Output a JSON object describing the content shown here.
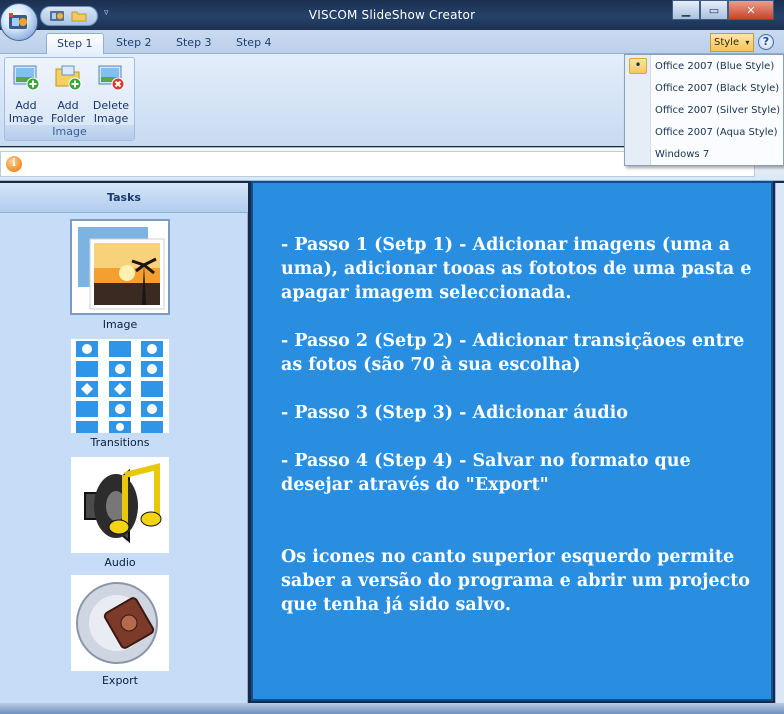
{
  "window": {
    "title": "VISCOM SlideShow Creator",
    "controls": {
      "minimize": "▁",
      "maximize": "▭",
      "close": "✕"
    }
  },
  "tabs": [
    "Step 1",
    "Step 2",
    "Step 3",
    "Step 4"
  ],
  "active_tab": "Step 1",
  "style_button": "Style",
  "help_button": "?",
  "ribbon": {
    "group_label": "Image",
    "buttons": [
      {
        "line1": "Add",
        "line2": "Image",
        "icon": "add-image-icon"
      },
      {
        "line1": "Add",
        "line2": "Folder",
        "icon": "add-folder-icon"
      },
      {
        "line1": "Delete",
        "line2": "Image",
        "icon": "delete-image-icon"
      }
    ]
  },
  "info_icon": "i",
  "tasks": {
    "header": "Tasks",
    "items": [
      "Image",
      "Transitions",
      "Audio",
      "Export"
    ]
  },
  "main_text": {
    "p1": "- Passo 1 (Setp 1) - Adicionar imagens (uma a uma), adicionar tooas as fototos de uma pasta e apagar imagem seleccionada.",
    "p2": "- Passo 2 (Setp 2) - Adicionar transiçãoes entre as fotos (são 70 à sua escolha)",
    "p3": "- Passo 3 (Step 3) - Adicionar áudio",
    "p4": "- Passo 4 (Step 4) - Salvar no formato que desejar através do \"Export\"",
    "p5": "Os icones no canto superior esquerdo permite saber a versão do programa e abrir um projecto que tenha já sido salvo."
  },
  "style_menu": {
    "items": [
      "Office 2007 (Blue Style)",
      "Office 2007 (Black Style)",
      "Office 2007 (Silver Style)",
      "Office 2007 (Aqua Style)",
      "Windows 7"
    ],
    "selected": "Office 2007 (Blue Style)",
    "check_mark": "•"
  },
  "colors": {
    "main_background": "#2a8ee0",
    "main_text": "#ffffff",
    "task_panel": "#c6dcf7",
    "style_button": "#f5c35a"
  }
}
